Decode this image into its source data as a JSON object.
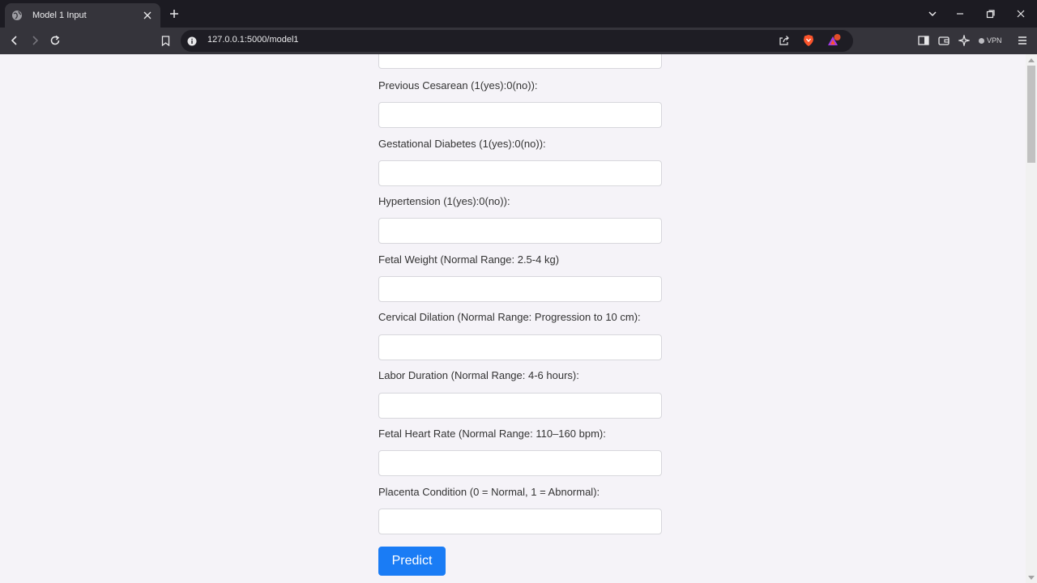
{
  "browser": {
    "tab_title": "Model 1 Input",
    "url": "127.0.0.1:5000/model1",
    "vpn_label": "VPN",
    "accent_brave": "#fb542b",
    "notification_badge": "#e14d2a"
  },
  "form": {
    "fields": [
      {
        "label": "Previous Cesarean (1(yes):0(no)):",
        "value": ""
      },
      {
        "label": "Gestational Diabetes (1(yes):0(no)):",
        "value": ""
      },
      {
        "label": "Hypertension (1(yes):0(no)):",
        "value": ""
      },
      {
        "label": "Fetal Weight (Normal Range: 2.5-4 kg)",
        "value": ""
      },
      {
        "label": "Cervical Dilation (Normal Range: Progression to 10 cm):",
        "value": ""
      },
      {
        "label": "Labor Duration (Normal Range: 4-6 hours):",
        "value": ""
      },
      {
        "label": "Fetal Heart Rate (Normal Range: 110–160 bpm):",
        "value": ""
      },
      {
        "label": "Placenta Condition (0 = Normal, 1 = Abnormal):",
        "value": ""
      }
    ],
    "submit_label": "Predict",
    "button_color": "#1a7cf5"
  }
}
